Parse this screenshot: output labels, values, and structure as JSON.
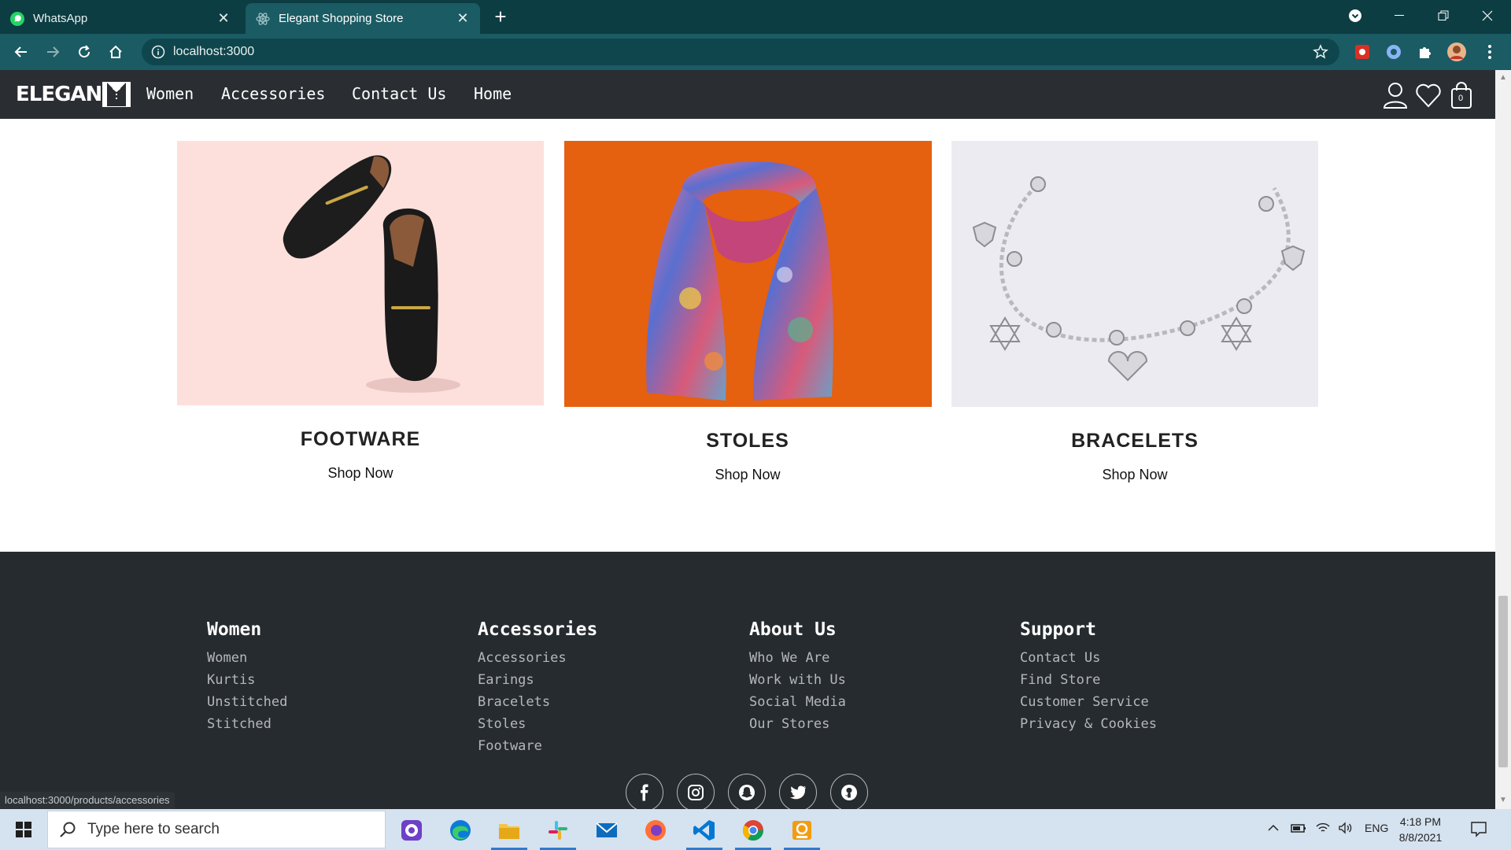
{
  "browser": {
    "tabs": [
      {
        "title": "WhatsApp",
        "active": false,
        "icon": "whatsapp-icon"
      },
      {
        "title": "Elegant Shopping Store",
        "active": true,
        "icon": "react-icon"
      }
    ],
    "url": "localhost:3000",
    "status_url": "localhost:3000/products/accessories"
  },
  "site": {
    "logo_text": "ELEGAN",
    "nav": [
      "Women",
      "Accessories",
      "Contact Us",
      "Home"
    ],
    "cart_count": "0",
    "cards": [
      {
        "title": "FOOTWARE",
        "link": "Shop Now",
        "bg": "#fde0dc"
      },
      {
        "title": "STOLES",
        "link": "Shop Now",
        "bg": "#e5600f"
      },
      {
        "title": "BRACELETS",
        "link": "Shop Now",
        "bg": "#ecebf1"
      }
    ],
    "footer": {
      "columns": [
        {
          "heading": "Women",
          "items": [
            "Women",
            "Kurtis",
            "Unstitched",
            "Stitched"
          ]
        },
        {
          "heading": "Accessories",
          "items": [
            "Accessories",
            "Earings",
            "Bracelets",
            "Stoles",
            "Footware"
          ]
        },
        {
          "heading": "About Us",
          "items": [
            "Who We Are",
            "Work with Us",
            "Social Media",
            "Our Stores"
          ]
        },
        {
          "heading": "Support",
          "items": [
            "Contact Us",
            "Find Store",
            "Customer Service",
            "Privacy & Cookies"
          ]
        }
      ],
      "social": [
        "facebook-icon",
        "instagram-icon",
        "snapchat-icon",
        "twitter-icon",
        "github-icon"
      ]
    }
  },
  "taskbar": {
    "search_placeholder": "Type here to search",
    "language": "ENG",
    "time": "4:18 PM",
    "date": "8/8/2021"
  },
  "colors": {
    "tabstrip": "#0c3d43",
    "toolbar": "#1b5b63",
    "site_nav": "#2a2e33",
    "footer": "#262b2f"
  }
}
